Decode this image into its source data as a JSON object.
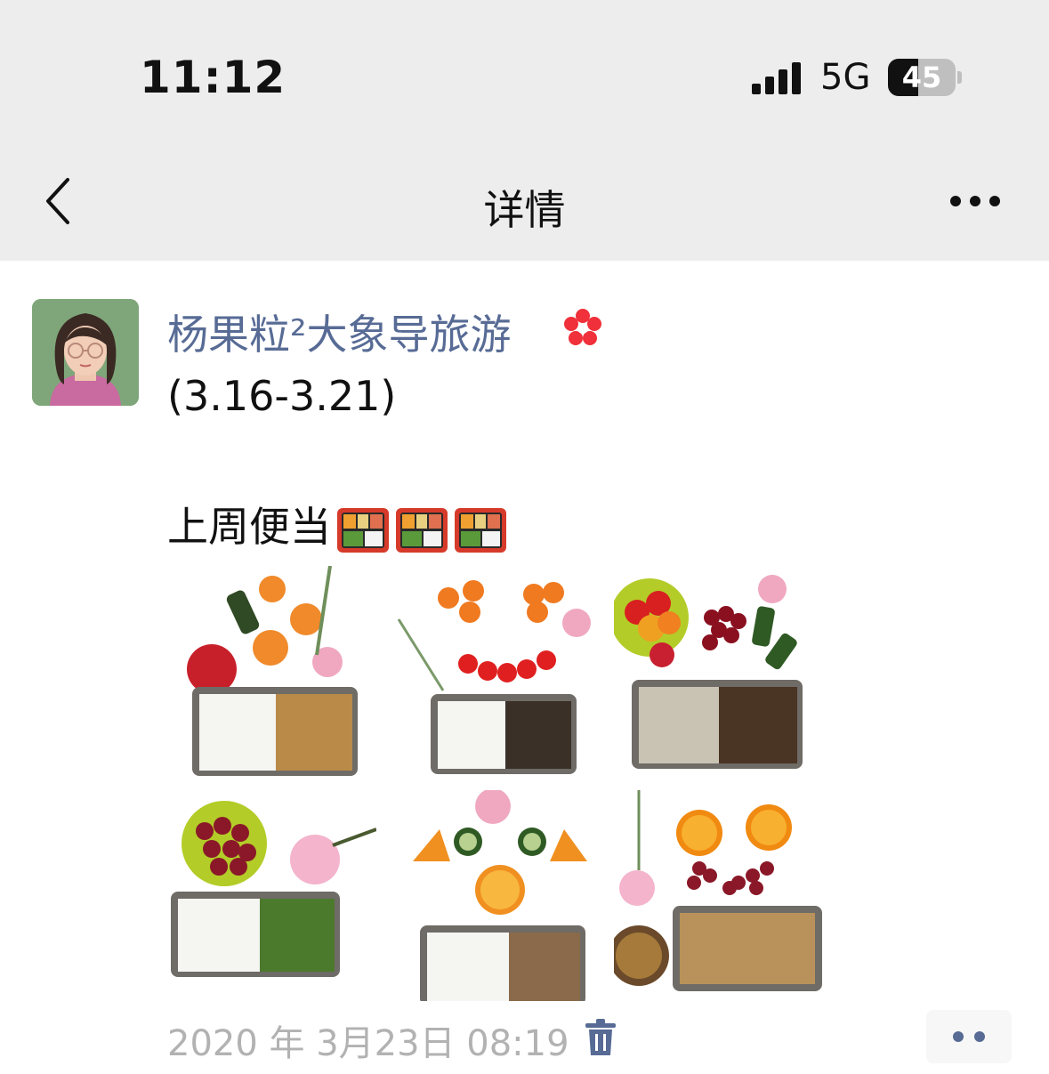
{
  "status_bar": {
    "time": "11:12",
    "network": "5G",
    "battery": "45"
  },
  "nav": {
    "title": "详情"
  },
  "post": {
    "author": "杨果粒²大象导旅游",
    "line1": "(3.16-3.21)",
    "line2": "上周便当",
    "photos": [
      {
        "name": "bento-photo-1"
      },
      {
        "name": "bento-photo-2"
      },
      {
        "name": "bento-photo-3"
      },
      {
        "name": "bento-photo-4"
      },
      {
        "name": "bento-photo-5"
      },
      {
        "name": "bento-photo-6"
      }
    ],
    "timestamp": "2020 年 3月23日 08:19"
  },
  "colors": {
    "header_bg": "#ededed",
    "link": "#576b95",
    "timestamp": "#b2b2b2",
    "accent_red": "#fa3a3a"
  }
}
